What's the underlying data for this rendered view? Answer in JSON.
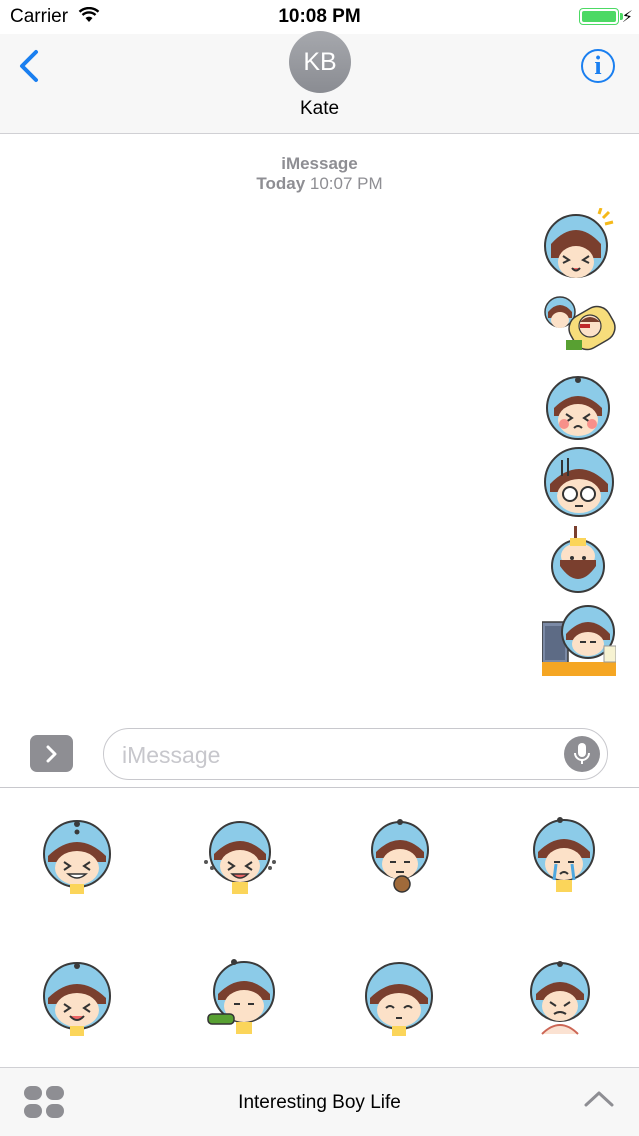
{
  "status_bar": {
    "carrier": "Carrier",
    "time": "10:08 PM",
    "battery_level": 1.0
  },
  "header": {
    "avatar_initials": "KB",
    "contact_name": "Kate"
  },
  "conversation": {
    "service": "iMessage",
    "day": "Today",
    "time": "10:07 PM",
    "stickers": [
      "laughing-boy-sticker",
      "sleeping-pair-sticker",
      "blushing-boy-sticker",
      "glasses-boy-sticker",
      "upside-down-boy-sticker",
      "computer-desk-sticker"
    ]
  },
  "input": {
    "placeholder": "iMessage"
  },
  "sticker_drawer": {
    "stickers": [
      "grinning-boy",
      "teary-laugh-boy",
      "pointing-boy",
      "crying-boy",
      "giggling-boy",
      "sneezing-boy",
      "smirking-boy",
      "drooling-boy"
    ]
  },
  "app_bar": {
    "title": "Interesting Boy Life"
  },
  "colors": {
    "accent": "#1a7ff0",
    "battery": "#4cd964",
    "sticker_head": "#8ccbe8",
    "hair": "#7a3f2e",
    "skin": "#fce1c8",
    "shirt": "#fbd55a"
  }
}
